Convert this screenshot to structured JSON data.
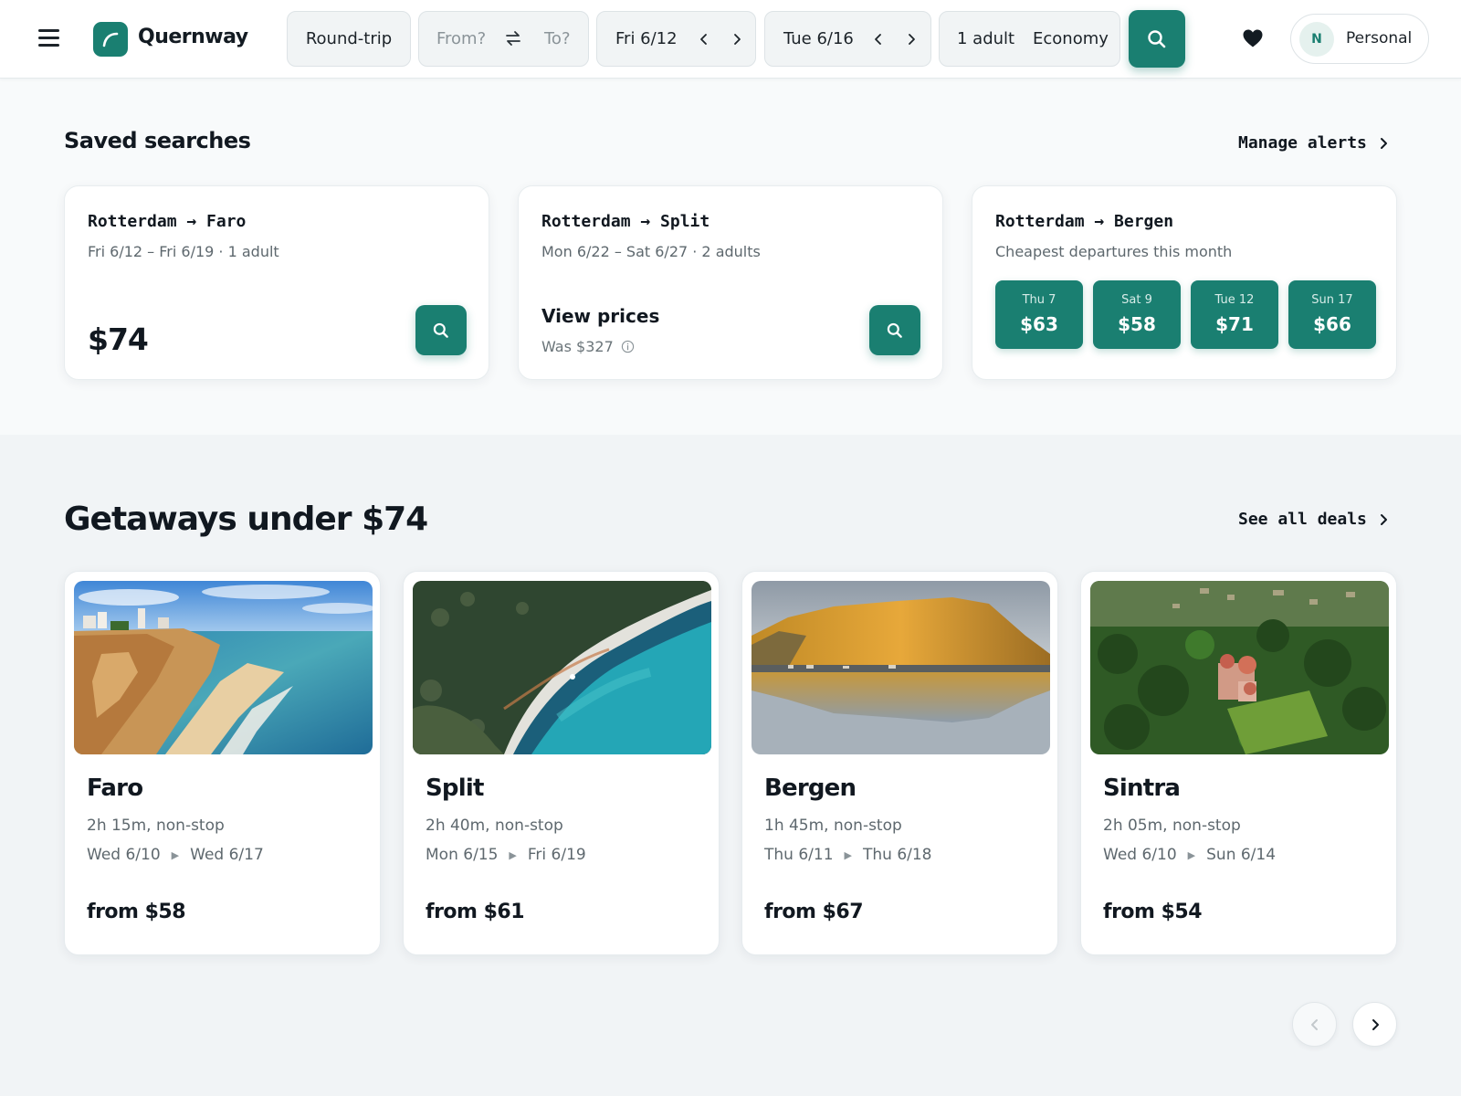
{
  "header": {
    "app_name": "Quernway",
    "trip_type": "Round-trip",
    "from_placeholder": "From?",
    "to_placeholder": "To?",
    "depart_date": "Fri 6/12",
    "return_date": "Tue 6/16",
    "passengers": "1 adult",
    "cabin": "Economy",
    "profile_initial": "N",
    "profile_name": "Personal"
  },
  "saved": {
    "title": "Saved searches",
    "manage_label": "Manage alerts",
    "cards": [
      {
        "route": "Rotterdam → Faro",
        "details": "Fri 6/12 – Fri 6/19 · 1 adult",
        "price": "$74"
      },
      {
        "route": "Rotterdam → Split",
        "details": "Mon 6/22 – Sat 6/27 · 2 adults",
        "view_label": "View prices",
        "was": "Was $327"
      },
      {
        "route": "Rotterdam → Bergen",
        "details": "Cheapest departures this month",
        "chips": [
          {
            "day": "Thu 7",
            "price": "$63"
          },
          {
            "day": "Sat 9",
            "price": "$58"
          },
          {
            "day": "Tue 12",
            "price": "$71"
          },
          {
            "day": "Sun 17",
            "price": "$66"
          }
        ]
      }
    ]
  },
  "deals": {
    "title": "Getaways under $74",
    "see_all_label": "See all deals",
    "items": [
      {
        "city": "Faro",
        "duration": "2h 15m, non-stop",
        "out": "Wed 6/10",
        "back": "Wed 6/17",
        "price": "from $58",
        "image": "beach-cliffs"
      },
      {
        "city": "Split",
        "duration": "2h 40m, non-stop",
        "out": "Mon 6/15",
        "back": "Fri 6/19",
        "price": "from $61",
        "image": "turquoise-bay-aerial"
      },
      {
        "city": "Bergen",
        "duration": "1h 45m, non-stop",
        "out": "Thu 6/11",
        "back": "Thu 6/18",
        "price": "from $67",
        "image": "mountain-lake-reflection"
      },
      {
        "city": "Sintra",
        "duration": "2h 05m, non-stop",
        "out": "Wed 6/10",
        "back": "Sun 6/14",
        "price": "from $54",
        "image": "palace-forest-aerial"
      }
    ]
  },
  "colors": {
    "accent": "#1a7f71",
    "text": "#111820",
    "muted": "#5e686e"
  }
}
